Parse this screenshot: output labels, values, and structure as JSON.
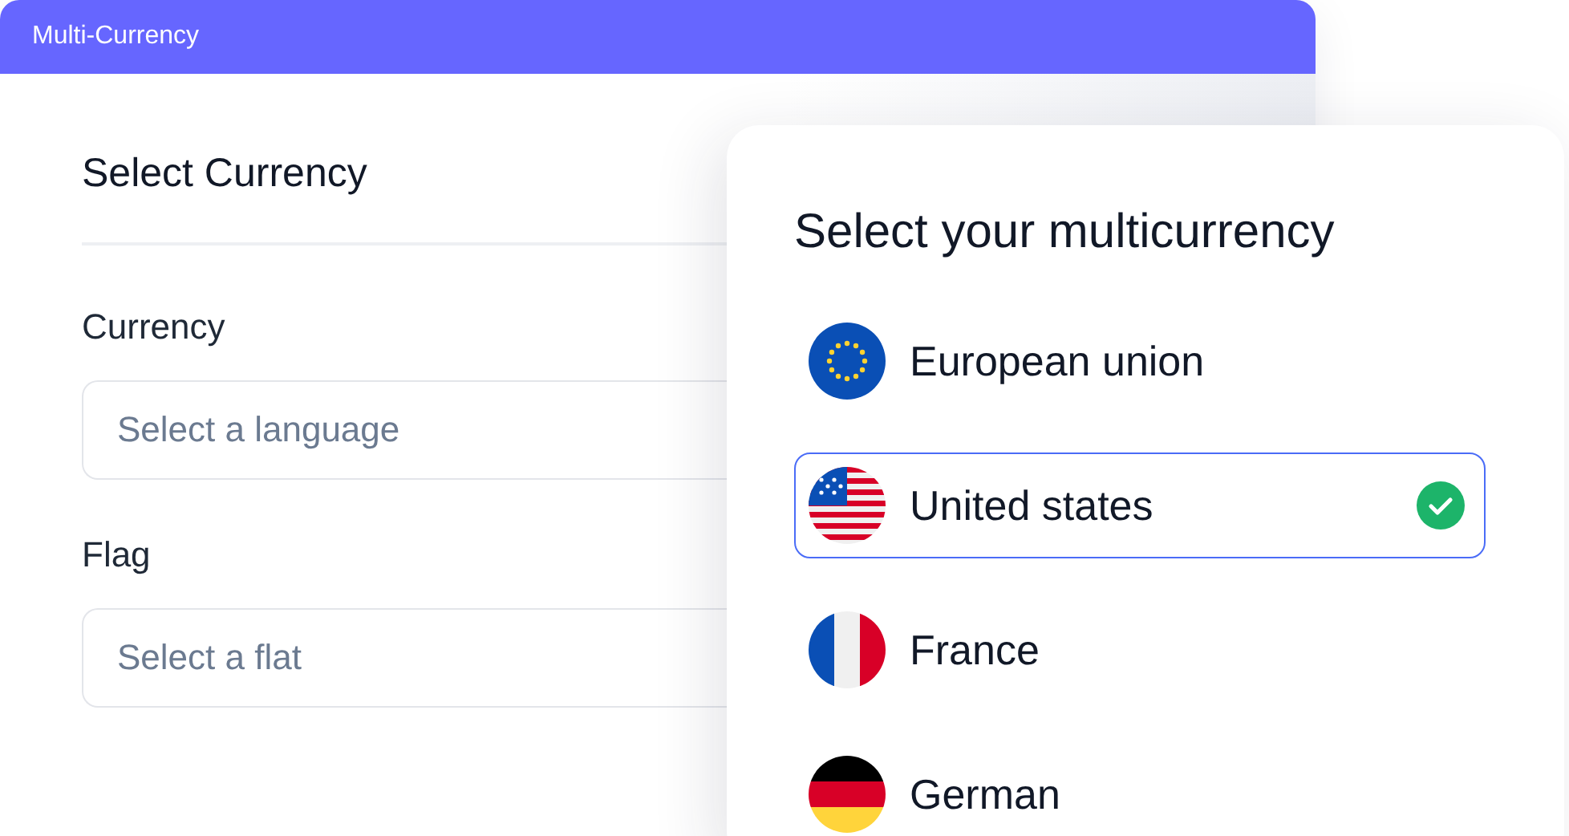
{
  "window": {
    "title": "Multi-Currency"
  },
  "form": {
    "heading": "Select Currency",
    "fields": [
      {
        "label": "Currency",
        "placeholder": "Select a language"
      },
      {
        "label": "Flag",
        "placeholder": "Select a flat"
      }
    ]
  },
  "currency_panel": {
    "title": "Select your multicurrency",
    "items": [
      {
        "label": "European union",
        "kind": "eu",
        "selected": false
      },
      {
        "label": "United states",
        "kind": "us",
        "selected": true
      },
      {
        "label": "France",
        "kind": "fr",
        "selected": false
      },
      {
        "label": "German",
        "kind": "de",
        "selected": false
      }
    ]
  }
}
